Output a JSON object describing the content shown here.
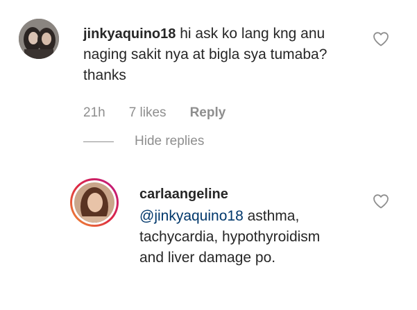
{
  "comment": {
    "username": "jinkyaquino18",
    "text": "hi ask ko lang kng anu naging sakit nya at bigla sya tumaba?thanks",
    "time": "21h",
    "likes": "7 likes",
    "reply_label": "Reply"
  },
  "thread": {
    "hide_replies_label": "Hide replies"
  },
  "reply": {
    "username": "carlaangeline",
    "mention": "@jinkyaquino18",
    "text": " asthma, tachycardia, hypothyroidism and liver damage po."
  },
  "icons": {
    "like": "heart-outline-icon"
  },
  "colors": {
    "text": "#262626",
    "muted": "#8e8e8e",
    "mention": "#00376b",
    "story_ring_start": "#f09433",
    "story_ring_end": "#bc1888"
  }
}
